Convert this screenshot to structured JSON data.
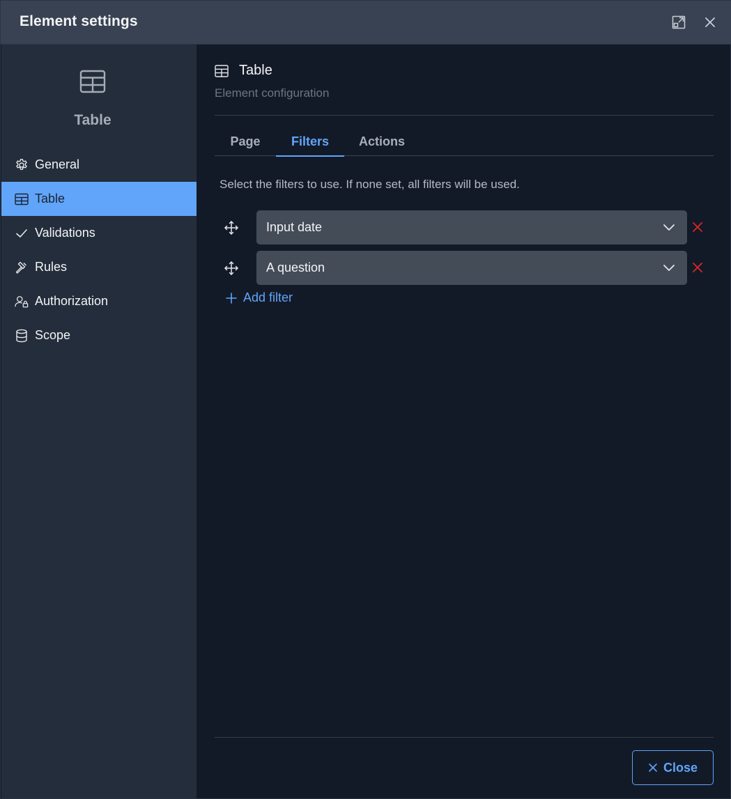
{
  "dialog": {
    "title": "Element settings",
    "expand_icon": "expand-icon",
    "close_icon": "close-icon"
  },
  "sidebar": {
    "hero_icon": "table-icon",
    "hero_title": "Table",
    "items": [
      {
        "label": "General",
        "icon": "gear-icon",
        "active": false
      },
      {
        "label": "Table",
        "icon": "table-icon",
        "active": true
      },
      {
        "label": "Validations",
        "icon": "check-icon",
        "active": false
      },
      {
        "label": "Rules",
        "icon": "gavel-icon",
        "active": false
      },
      {
        "label": "Authorization",
        "icon": "user-lock-icon",
        "active": false
      },
      {
        "label": "Scope",
        "icon": "database-icon",
        "active": false
      }
    ]
  },
  "main": {
    "title": "Table",
    "subtitle": "Element configuration",
    "tabs": [
      {
        "label": "Page",
        "active": false
      },
      {
        "label": "Filters",
        "active": true
      },
      {
        "label": "Actions",
        "active": false
      }
    ],
    "helper_text": "Select the filters to use. If none set, all filters will be used.",
    "filters": [
      {
        "value": "Input date"
      },
      {
        "value": "A question"
      }
    ],
    "add_filter_label": "Add filter",
    "close_label": "Close"
  },
  "colors": {
    "accent": "#60a5fa",
    "remove": "#dc2626",
    "header_bg": "#384252",
    "sidebar_bg": "#242d3b",
    "main_bg": "#131a27",
    "select_bg": "#444c58"
  }
}
